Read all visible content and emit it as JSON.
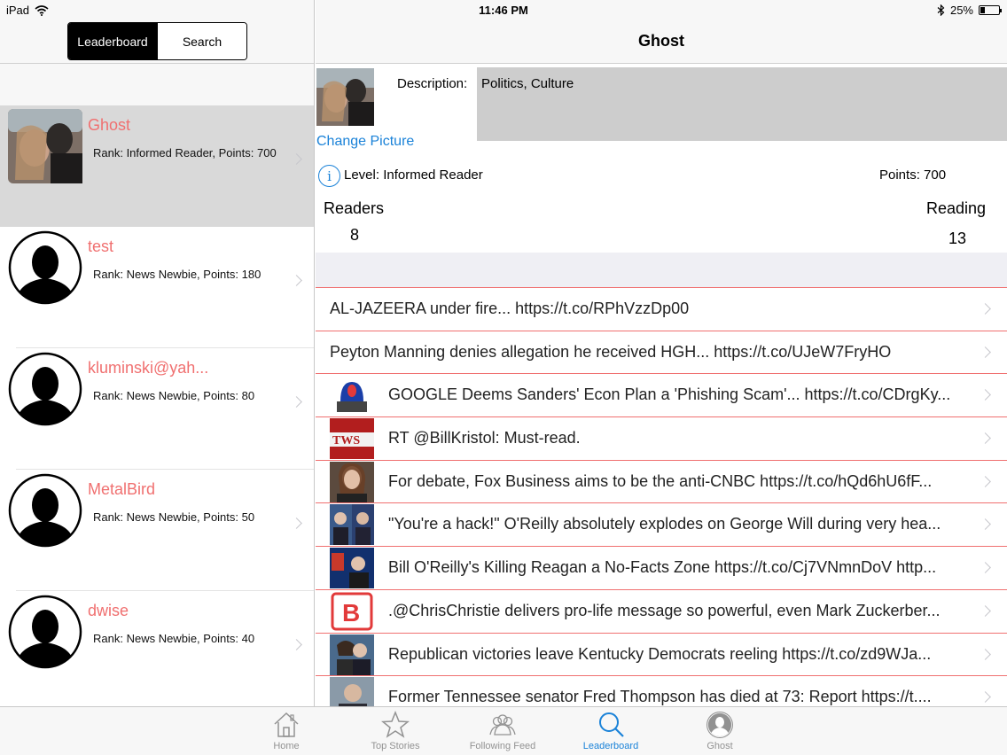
{
  "status_bar": {
    "device": "iPad",
    "time": "11:46 PM",
    "battery": "25%",
    "battery_level": 0.25
  },
  "left": {
    "segments": [
      {
        "label": "Leaderboard",
        "active": true
      },
      {
        "label": "Search",
        "active": false
      }
    ],
    "users": [
      {
        "name": "Ghost",
        "rank": "Rank: Informed Reader, Points: 700",
        "selected": true,
        "avatar": "photo"
      },
      {
        "name": "test",
        "rank": "Rank: News Newbie, Points: 180",
        "selected": false,
        "avatar": "default"
      },
      {
        "name": "kluminski@yah...",
        "rank": "Rank: News Newbie, Points: 80",
        "selected": false,
        "avatar": "default"
      },
      {
        "name": "MetalBird",
        "rank": "Rank: News Newbie, Points: 50",
        "selected": false,
        "avatar": "default"
      },
      {
        "name": "dwise",
        "rank": "Rank: News Newbie, Points: 40",
        "selected": false,
        "avatar": "default"
      }
    ]
  },
  "profile": {
    "title": "Ghost",
    "description_label": "Description:",
    "description": "Politics, Culture",
    "change_picture": "Change Picture",
    "level": "Level: Informed Reader",
    "points": "Points: 700",
    "readers_label": "Readers",
    "readers_count": "8",
    "reading_label": "Reading",
    "reading_count": "13"
  },
  "feed": [
    {
      "text": "AL-JAZEERA under fire... https://t.co/RPhVzzDp00",
      "thumb": null
    },
    {
      "text": "Peyton Manning denies allegation he received HGH... https://t.co/UJeW7FryHO",
      "thumb": null
    },
    {
      "text": "GOOGLE Deems Sanders' Econ Plan a 'Phishing Scam'... https://t.co/CDrgKy...",
      "thumb": "siren"
    },
    {
      "text": "RT @BillKristol: Must-read.",
      "thumb": "tws"
    },
    {
      "text": "For debate, Fox Business aims to be the anti-CNBC https://t.co/hQd6hU6fF...",
      "thumb": "anchor"
    },
    {
      "text": "\"You're a hack!\" O'Reilly absolutely explodes on George Will during very hea...",
      "thumb": "split"
    },
    {
      "text": "Bill O'Reilly's Killing Reagan a No-Facts Zone https://t.co/Cj7VNmnDoV http...",
      "thumb": "oreilly"
    },
    {
      "text": ".@ChrisChristie delivers pro-life message so powerful, even Mark Zuckerber...",
      "thumb": "b-logo"
    },
    {
      "text": "Republican victories leave Kentucky Democrats reeling https://t.co/zd9WJa...",
      "thumb": "couple"
    },
    {
      "text": "Former Tennessee senator Fred Thompson has died at 73: Report https://t....",
      "thumb": "senator"
    }
  ],
  "tabs": [
    {
      "label": "Home",
      "icon": "house-icon",
      "active": false
    },
    {
      "label": "Top Stories",
      "icon": "star-icon",
      "active": false
    },
    {
      "label": "Following Feed",
      "icon": "people-icon",
      "active": false
    },
    {
      "label": "Leaderboard",
      "icon": "magnifier-icon",
      "active": true
    },
    {
      "label": "Ghost",
      "icon": "profile-icon",
      "active": false
    }
  ],
  "colors": {
    "accent": "#1a82d8",
    "name_red": "#f07070",
    "selected_row": "#d9d9d9"
  }
}
